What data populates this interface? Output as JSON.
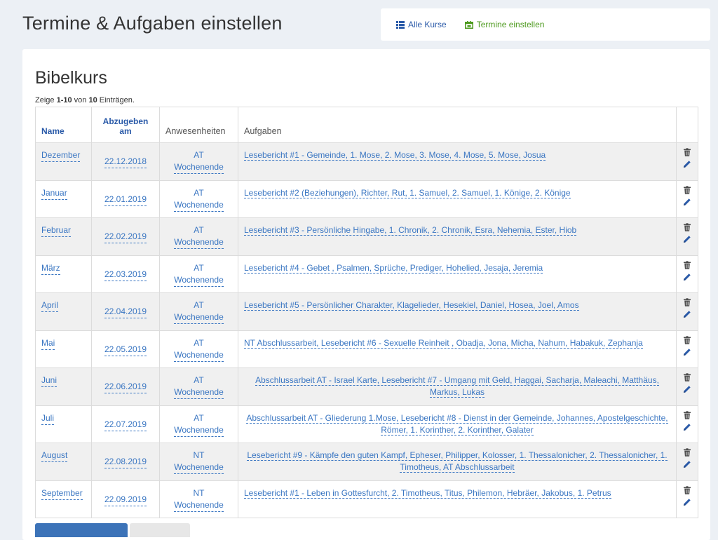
{
  "page": {
    "title": "Termine & Aufgaben einstellen"
  },
  "nav": {
    "all_courses": "Alle Kurse",
    "set_dates": "Termine einstellen",
    "all_courses_icon": "list-icon",
    "set_dates_icon": "calendar-icon",
    "colors": {
      "blue": "#2a5aa8",
      "green": "#4e9a1f"
    }
  },
  "course": {
    "title": "Bibelkurs"
  },
  "summary": {
    "prefix": "Zeige ",
    "range": "1-10",
    "middle": " von ",
    "total": "10",
    "suffix": " Einträgen."
  },
  "table": {
    "headers": {
      "name": "Name",
      "due_line1": "Abzugeben",
      "due_line2": "am",
      "attendance": "Anwesenheiten",
      "tasks": "Aufgaben"
    },
    "rows": [
      {
        "name": "Dezember",
        "date": "22.12.2018",
        "att1": "AT",
        "att2": "Wochenende",
        "tasks": "Lesebericht #1 - Gemeinde, 1. Mose, 2. Mose, 3. Mose, 4. Mose, 5. Mose, Josua",
        "center": false
      },
      {
        "name": "Januar",
        "date": "22.01.2019",
        "att1": "AT",
        "att2": "Wochenende",
        "tasks": "Lesebericht #2 (Beziehungen), Richter, Rut, 1. Samuel, 2. Samuel, 1. Könige, 2. Könige",
        "center": false
      },
      {
        "name": "Februar",
        "date": "22.02.2019",
        "att1": "AT",
        "att2": "Wochenende",
        "tasks": "Lesebericht #3 - Persönliche Hingabe, 1. Chronik, 2. Chronik, Esra, Nehemia, Ester, Hiob",
        "center": false
      },
      {
        "name": "März",
        "date": "22.03.2019",
        "att1": "AT",
        "att2": "Wochenende",
        "tasks": "Lesebericht #4 - Gebet , Psalmen, Sprüche, Prediger, Hohelied, Jesaja, Jeremia",
        "center": false
      },
      {
        "name": "April",
        "date": "22.04.2019",
        "att1": "AT",
        "att2": "Wochenende",
        "tasks": "Lesebericht #5 - Persönlicher Charakter, Klagelieder, Hesekiel, Daniel, Hosea, Joel, Amos",
        "center": false
      },
      {
        "name": "Mai",
        "date": "22.05.2019",
        "att1": "AT",
        "att2": "Wochenende",
        "tasks": "NT Abschlussarbeit, Lesebericht #6 - Sexuelle Reinheit , Obadja, Jona, Micha, Nahum, Habakuk, Zephanja",
        "center": false
      },
      {
        "name": "Juni",
        "date": "22.06.2019",
        "att1": "AT",
        "att2": "Wochenende",
        "tasks": "Abschlussarbeit AT - Israel Karte, Lesebericht #7 - Umgang mit Geld, Haggai, Sacharja, Maleachi, Matthäus, Markus, Lukas",
        "center": true
      },
      {
        "name": "Juli",
        "date": "22.07.2019",
        "att1": "AT",
        "att2": "Wochenende",
        "tasks": "Abschlussarbeit AT - Gliederung 1.Mose, Lesebericht #8 - Dienst in der Gemeinde, Johannes, Apostelgeschichte, Römer, 1. Korinther, 2. Korinther, Galater",
        "center": true
      },
      {
        "name": "August",
        "date": "22.08.2019",
        "att1": "NT",
        "att2": "Wochenende",
        "tasks": "Lesebericht #9 - Kämpfe den guten Kampf, Epheser, Philipper, Kolosser, 1. Thessalonicher, 2. Thessalonicher, 1. Timotheus, AT Abschlussarbeit",
        "center": true
      },
      {
        "name": "September",
        "date": "22.09.2019",
        "att1": "NT",
        "att2": "Wochenende",
        "tasks": "Lesebericht #1 - Leben in Gottesfurcht, 2. Timotheus, Titus, Philemon, Hebräer, Jakobus, 1. Petrus",
        "center": false
      }
    ],
    "action_icons": [
      "trash-icon",
      "pencil-icon"
    ],
    "link_color": "#3a76c2"
  }
}
